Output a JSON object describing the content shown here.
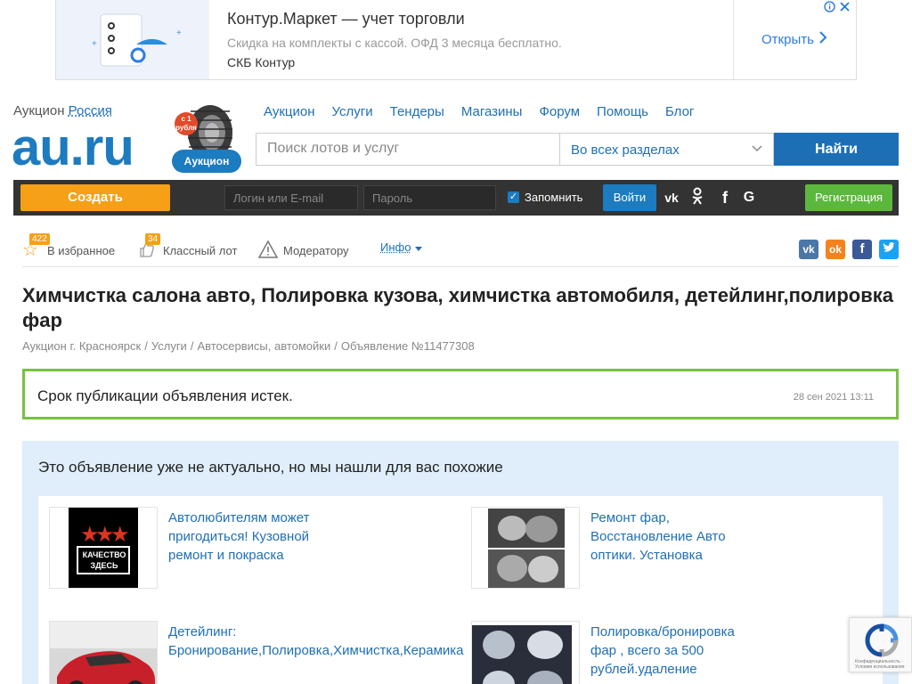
{
  "ad": {
    "title": "Контур.Маркет — учет торговли",
    "description": "Скидка на комплекты с кассой. ОФД 3 месяца бесплатно.",
    "brand": "СКБ Контур",
    "open_label": "Открыть"
  },
  "header": {
    "auction_prefix": "Аукцион",
    "region": "Россия",
    "logo": "au.ru",
    "tire_badge": "с 1 рубля",
    "tire_label": "Аукцион",
    "nav": [
      "Аукцион",
      "Услуги",
      "Тендеры",
      "Магазины",
      "Форум",
      "Помощь",
      "Блог"
    ],
    "search_placeholder": "Поиск лотов и услуг",
    "search_scope": "Во всех разделах",
    "search_button": "Найти"
  },
  "userbar": {
    "create_label": "Создать",
    "login_placeholder": "Логин или E-mail",
    "password_placeholder": "Пароль",
    "remember_label": "Запомнить",
    "login_button": "Войти",
    "register_button": "Регистрация"
  },
  "actions": {
    "favorites_label": "В избранное",
    "favorites_count": "422",
    "cool_label": "Классный лот",
    "cool_count": "34",
    "moderator_label": "Модератору",
    "info_label": "Инфо"
  },
  "listing": {
    "title": "Химчистка салона авто, Полировка кузова, химчистка автомобиля, детейлинг,полировка фар",
    "breadcrumb": [
      "Аукцион г. Красноярск",
      "Услуги",
      "Автосервисы, автомойки",
      "Объявление №11477308"
    ],
    "expired_message": "Срок публикации объявления истек.",
    "expired_date": "28 сен 2021 13:11"
  },
  "similar": {
    "heading": "Это объявление уже не актуально, но мы нашли для вас похожие",
    "items": [
      {
        "title": "Автолюбителям может пригодиться! Кузовной ремонт и покраска",
        "thumb_text": "КАЧЕСТВО ЗДЕСЬ"
      },
      {
        "title": "Ремонт фар, Восстановление Авто оптики. Установка"
      },
      {
        "title": "Детейлинг: Бронирование,Полировка,Химчистка,Керамика"
      },
      {
        "title": "Полировка/бронировка фар , всего за 500 рублей.удаление"
      }
    ]
  },
  "recaptcha": {
    "text": "Конфиденциальность - Условия использования"
  },
  "colors": {
    "brand_blue": "#1d7bbf",
    "create_orange": "#f5a017",
    "register_green": "#5cb83c",
    "expired_border": "#7ac143",
    "similar_bg": "#dfeefa"
  }
}
